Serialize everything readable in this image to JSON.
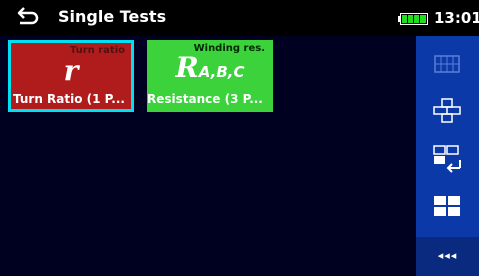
{
  "header": {
    "back_icon": "back-arrow-icon",
    "title": "Single Tests",
    "time": "13:01",
    "battery_icon": "battery-full-icon"
  },
  "tiles": [
    {
      "small_label": "Turn ratio",
      "symbol": "r",
      "subscript": "",
      "label": "Turn Ratio (1 P...",
      "color": "#b01c1c",
      "selected": true
    },
    {
      "small_label": "Winding res.",
      "symbol": "R",
      "subscript": "A,B,C",
      "label": "Resistance (3 P...",
      "color": "#3bd23b",
      "selected": false
    }
  ],
  "sidebar": {
    "buttons": [
      {
        "icon": "grid-view-icon"
      },
      {
        "icon": "cross-view-icon"
      },
      {
        "icon": "swap-view-icon"
      },
      {
        "icon": "split-view-icon"
      }
    ],
    "more_label": "◂◂◂"
  },
  "colors": {
    "accent": "#00e0f0",
    "sidebar": "#0b3aa8",
    "background": "#000020"
  }
}
